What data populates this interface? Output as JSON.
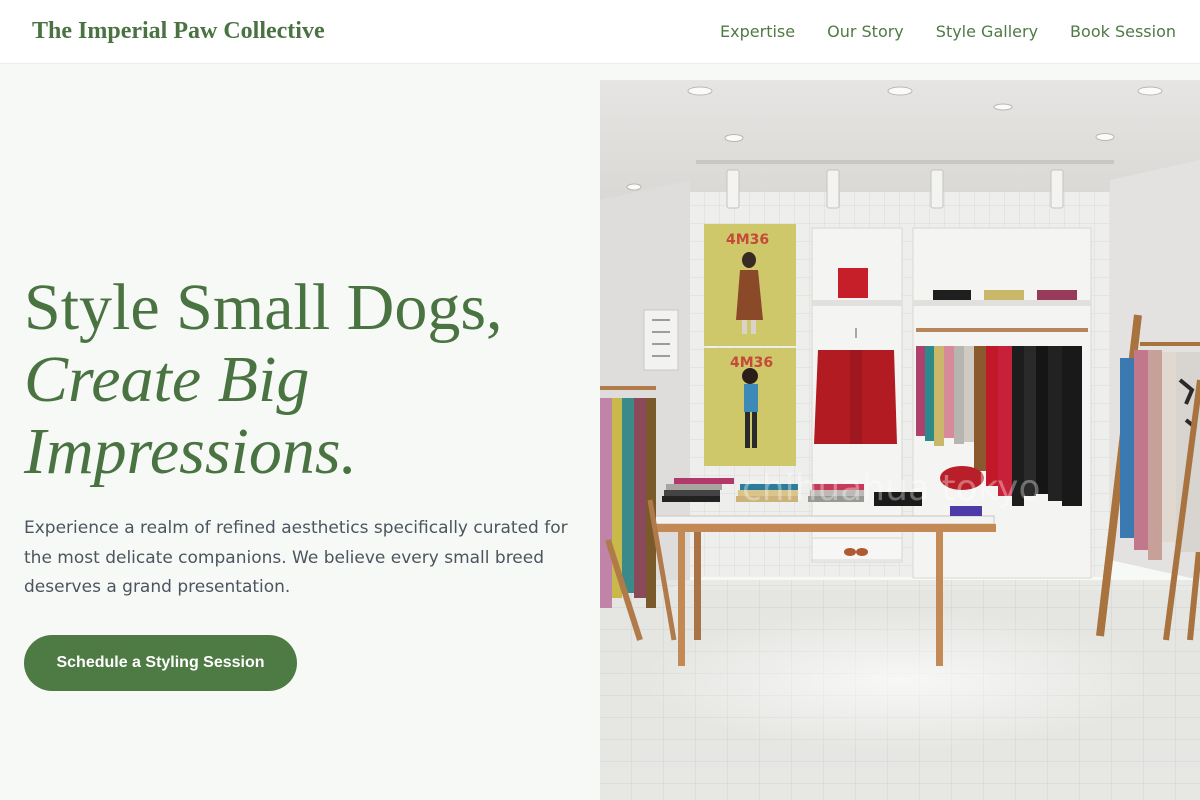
{
  "brand": {
    "name": "The Imperial Paw Collective"
  },
  "nav": {
    "items": [
      "Expertise",
      "Our Story",
      "Style Gallery",
      "Book Session"
    ]
  },
  "hero": {
    "headline_line1": "Style Small Dogs,",
    "headline_line2": "Create Big",
    "headline_line3": "Impressions.",
    "lede": "Experience a realm of refined aesthetics specifically curated for the most delicate companions. We believe every small breed deserves a grand presentation.",
    "cta_label": "Schedule a Styling Session"
  },
  "photo": {
    "poster_label_top": "4M36",
    "poster_label_bottom": "4M36",
    "watermark": "chihuahua tokyo"
  },
  "colors": {
    "accent": "#4e7a43",
    "heading": "#4a7342",
    "body_text": "#4b5560",
    "page_bg": "#f7f9f6"
  }
}
